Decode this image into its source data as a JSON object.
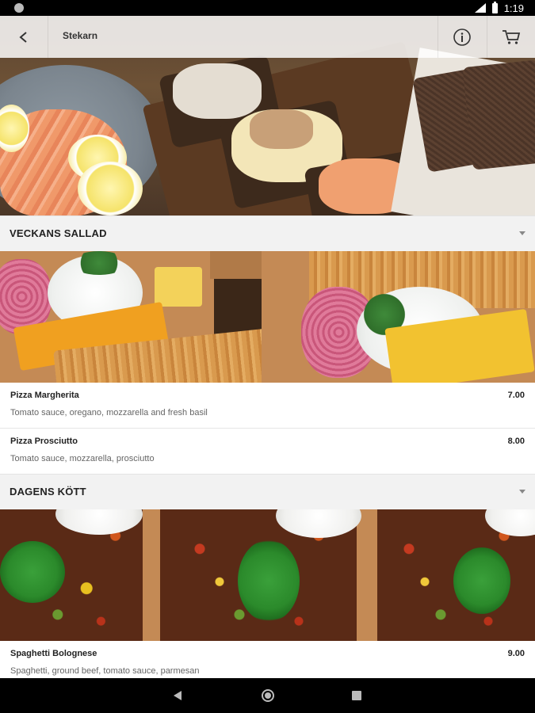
{
  "status_bar": {
    "time": "1:19"
  },
  "app_bar": {
    "title": "Stekarn"
  },
  "sections": [
    {
      "title": "VECKANS SALLAD",
      "items": [
        {
          "name": "Pizza Margherita",
          "price": "7.00",
          "description": "Tomato sauce, oregano, mozzarella and fresh basil"
        },
        {
          "name": "Pizza Prosciutto",
          "price": "8.00",
          "description": "Tomato sauce, mozzarella, prosciutto"
        }
      ]
    },
    {
      "title": "DAGENS KÖTT",
      "items": [
        {
          "name": "Spaghetti Bolognese",
          "price": "9.00",
          "description": "Spaghetti, ground beef, tomato sauce, parmesan"
        }
      ]
    }
  ],
  "icons": {
    "back": "arrow-left-icon",
    "info": "info-icon",
    "cart": "cart-icon",
    "chevron": "chevron-down-icon",
    "nav_back": "nav-back-icon",
    "nav_home": "nav-home-icon",
    "nav_recents": "nav-recents-icon"
  },
  "colors": {
    "section_bg": "#f2f2f2",
    "text_primary": "#222222",
    "text_secondary": "#666666"
  }
}
